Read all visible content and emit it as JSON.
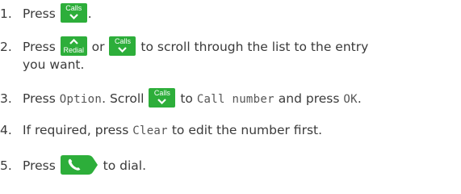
{
  "colors": {
    "key_green": "#2dae3a",
    "text": "#3a3a3a"
  },
  "keys": {
    "calls": "Calls",
    "redial": "Redial"
  },
  "steps": [
    {
      "number": "1.",
      "press": "Press",
      "end": "."
    },
    {
      "number": "2.",
      "press": "Press",
      "or": "or",
      "rest": "to scroll through the list to the entry",
      "rest2": "you want."
    },
    {
      "number": "3.",
      "press": "Press",
      "option": "Option",
      "scroll": ". Scroll",
      "to": "to",
      "call_number": "Call number",
      "and_press": "and press",
      "ok": "OK",
      "end": "."
    },
    {
      "number": "4.",
      "text_a": "If required, press",
      "clear": "Clear",
      "text_b": "to edit the number first."
    },
    {
      "number": "5.",
      "press": "Press",
      "end": "to dial."
    }
  ],
  "icons": [
    "chevron-down-icon",
    "chevron-up-icon",
    "phone-handset-icon"
  ]
}
